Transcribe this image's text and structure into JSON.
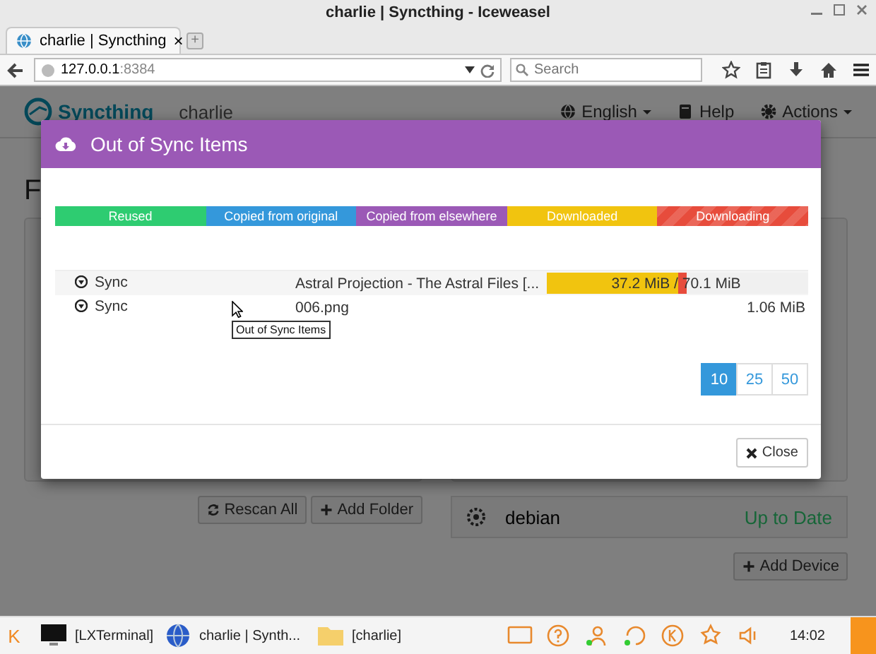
{
  "window": {
    "title": "charlie | Syncthing - Iceweasel"
  },
  "browser": {
    "tab": {
      "title": "charlie | Syncthing",
      "close": "×"
    },
    "new_tab": "+",
    "url": {
      "host": "127.0.0.1",
      "port": ":8384"
    },
    "search": {
      "placeholder": "Search"
    }
  },
  "page": {
    "brand": "Syncthing",
    "device_name": "charlie",
    "nav": [
      {
        "label": "English",
        "kind": "globe"
      },
      {
        "label": "Help",
        "kind": "book"
      },
      {
        "label": "Actions",
        "kind": "gear"
      }
    ],
    "heading": "F",
    "folder_buttons": [
      {
        "label": "Rescan All",
        "kind": "refresh"
      },
      {
        "label": "Add Folder",
        "kind": "plus"
      }
    ],
    "device": {
      "name": "debian",
      "status": "Up to Date"
    },
    "add_device": "Add Device"
  },
  "modal": {
    "title": "Out of Sync Items",
    "legend": [
      {
        "label": "Reused",
        "color": "#2ecc71"
      },
      {
        "label": "Copied from original",
        "color": "#3498db"
      },
      {
        "label": "Copied from elsewhere",
        "color": "#9b59b6"
      },
      {
        "label": "Downloaded",
        "color": "#f1c40f"
      },
      {
        "label": "Downloading",
        "color": "#e74c3c"
      }
    ],
    "rows": [
      {
        "action": "Sync",
        "name": "Astral Projection - The Astral Files [...",
        "size": "37.2 MiB / 70.1 MiB",
        "segments": [
          {
            "color": "#f1c40f",
            "level": 0.505
          },
          {
            "color": "#e74c3c",
            "level": 0.03
          }
        ]
      },
      {
        "action": "Sync",
        "name": "006.png",
        "size": "1.06 MiB"
      }
    ],
    "tooltip": "Out of Sync Items",
    "page_sizes": [
      {
        "label": "10",
        "selected": true
      },
      {
        "label": "25",
        "selected": false
      },
      {
        "label": "50",
        "selected": false
      }
    ],
    "close": "Close"
  },
  "taskbar": {
    "start": "K",
    "tasks": [
      {
        "label": "[LXTerminal]",
        "kind": "monitor"
      },
      {
        "label": "charlie | Synth...",
        "kind": "globe"
      },
      {
        "label": "[charlie]",
        "kind": "folder"
      }
    ],
    "clock": "14:02"
  }
}
